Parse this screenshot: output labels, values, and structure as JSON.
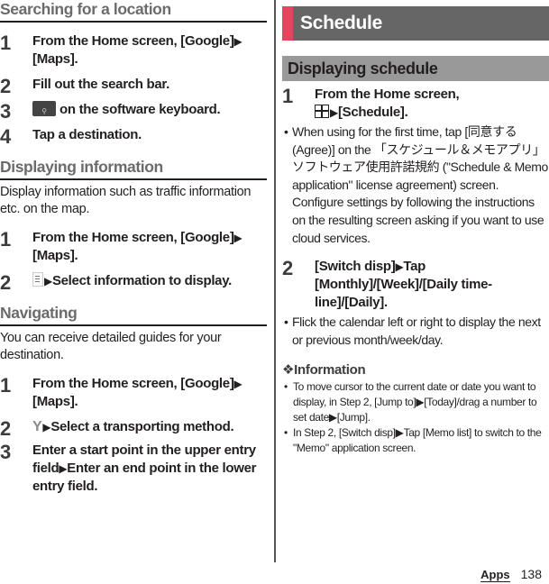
{
  "left": {
    "searching": {
      "title": "Searching for a location",
      "steps": [
        {
          "num": "1",
          "text_a": "From the Home screen, [Google]",
          "text_b": "[Maps]."
        },
        {
          "num": "2",
          "text": "Fill out the search bar."
        },
        {
          "num": "3",
          "icon": "search-key-icon",
          "text": "on the software keyboard."
        },
        {
          "num": "4",
          "text": "Tap a destination."
        }
      ]
    },
    "displaying": {
      "title": "Displaying information",
      "description": "Display information such as traffic information etc. on the map.",
      "steps": [
        {
          "num": "1",
          "text_a": "From the Home screen, [Google]",
          "text_b": "[Maps]."
        },
        {
          "num": "2",
          "icon": "menu-icon",
          "text": "Select information to display."
        }
      ]
    },
    "navigating": {
      "title": "Navigating",
      "description": "You can receive detailed guides for your destination.",
      "steps": [
        {
          "num": "1",
          "text_a": "From the Home screen, [Google]",
          "text_b": "[Maps]."
        },
        {
          "num": "2",
          "icon": "route-icon",
          "text": "Select a transporting method."
        },
        {
          "num": "3",
          "text_a": "Enter a start point in the upper entry field",
          "text_b": "Enter an end point in the lower entry field."
        }
      ]
    }
  },
  "right": {
    "banner_title": "Schedule",
    "subsection_title": "Displaying schedule",
    "steps": [
      {
        "num": "1",
        "text_a": "From the Home screen,",
        "icon": "apps-grid-icon",
        "text_b": "[Schedule].",
        "bullet": "When using for the first time, tap [同意する (Agree)] on the 「スケジュール＆メモアプリ」ソフトウェア使用許諾規約 (\"Schedule & Memo application\" license agreement) screen. Configure settings by following the instructions on the resulting screen asking if you want to use cloud services."
      },
      {
        "num": "2",
        "text_a": "[Switch disp]",
        "text_b": "Tap [Monthly]/[Week]/[Daily time-line]/[Daily].",
        "bullet": "Flick the calendar left or right to display the next or previous month/week/day."
      }
    ],
    "information": {
      "title": "❖Information",
      "items": [
        {
          "a": "To move cursor to the current date or date you want to display, in Step 2, [Jump to]",
          "b": "[Today]/drag a number to set date",
          "c": "[Jump]."
        },
        {
          "a": "In Step 2, [Switch disp]",
          "b": "Tap [Memo list] to switch to the \"Memo\" application screen."
        }
      ]
    }
  },
  "footer": {
    "section": "Apps",
    "page": "138"
  },
  "glyphs": {
    "arrow": "▶",
    "bullet": "•",
    "search_key": "🔍︎",
    "route": "Y"
  },
  "colors": {
    "accent": "#e0475e",
    "banner": "#666666",
    "subbanner": "#999999",
    "heading_gray": "#6b6b6b"
  }
}
